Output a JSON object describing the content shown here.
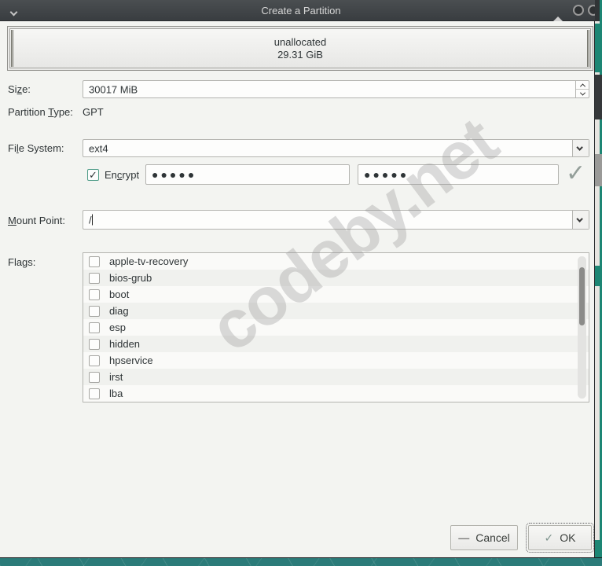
{
  "window": {
    "title": "Create a Partition"
  },
  "partition_preview": {
    "label": "unallocated",
    "size": "29.31 GiB"
  },
  "form": {
    "size": {
      "label_pre": "Si",
      "label_mn": "z",
      "label_post": "e:",
      "value": "30017 MiB"
    },
    "partition_type": {
      "label_pre": "Partition ",
      "label_mn": "T",
      "label_post": "ype:",
      "value": "GPT"
    },
    "file_system": {
      "label_pre": "Fi",
      "label_mn": "l",
      "label_post": "e System:",
      "value": "ext4"
    },
    "encrypt": {
      "label_pre": "En",
      "label_mn": "c",
      "label_post": "rypt",
      "checked": true,
      "check_glyph": "✓",
      "passphrase": "●●●●●",
      "confirm": "●●●●●",
      "valid_glyph": "✓"
    },
    "mount_point": {
      "label_pre": "",
      "label_mn": "M",
      "label_post": "ount Point:",
      "value": "/"
    },
    "flags": {
      "label": "Flags:",
      "items": [
        "apple-tv-recovery",
        "bios-grub",
        "boot",
        "diag",
        "esp",
        "hidden",
        "hpservice",
        "irst",
        "lba"
      ]
    }
  },
  "buttons": {
    "cancel": "Cancel",
    "cancel_icon": "—",
    "ok": "OK",
    "ok_icon": "✓"
  },
  "watermark": "codeby.net",
  "colors": {
    "titlebar": "#3c4043",
    "dialog_bg": "#f3f4f1",
    "accent_teal": "#1d8674",
    "checkbox_accent": "#4f9c88",
    "desktop": "#2b7b79"
  }
}
